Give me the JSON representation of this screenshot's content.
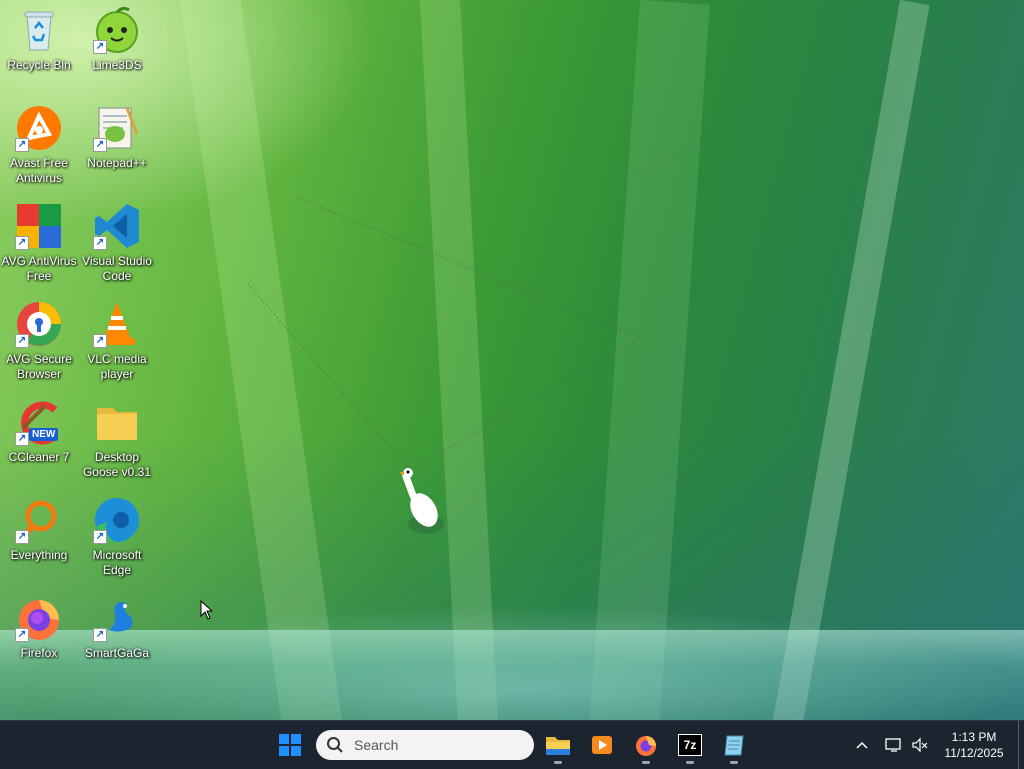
{
  "desktop_icons": [
    {
      "label": "Recycle Bin",
      "icon": "recycle-bin-icon"
    },
    {
      "label": "Lime3DS",
      "icon": "lime3ds-icon"
    },
    {
      "label": "Avast Free Antivirus",
      "icon": "avast-icon"
    },
    {
      "label": "Notepad++",
      "icon": "notepad-plus-plus-icon"
    },
    {
      "label": "AVG AntiVirus Free",
      "icon": "avg-antivirus-icon"
    },
    {
      "label": "Visual Studio Code",
      "icon": "vscode-icon"
    },
    {
      "label": "AVG Secure Browser",
      "icon": "avg-secure-browser-icon"
    },
    {
      "label": "VLC media player",
      "icon": "vlc-icon"
    },
    {
      "label": "CCleaner 7",
      "icon": "ccleaner-icon"
    },
    {
      "label": "Desktop Goose v0.31",
      "icon": "folder-icon"
    },
    {
      "label": "Everything",
      "icon": "everything-search-icon"
    },
    {
      "label": "Microsoft Edge",
      "icon": "edge-icon"
    },
    {
      "label": "Firefox",
      "icon": "firefox-icon"
    },
    {
      "label": "SmartGaGa",
      "icon": "smartgaga-icon"
    }
  ],
  "ccleaner_badge": "NEW",
  "taskbar": {
    "search_placeholder": "Search",
    "apps": [
      {
        "name": "File Explorer",
        "icon": "file-explorer-icon"
      },
      {
        "name": "Media Player",
        "icon": "media-player-icon"
      },
      {
        "name": "Firefox",
        "icon": "firefox-icon"
      },
      {
        "name": "7-Zip",
        "icon": "seven-zip-icon",
        "label": "7z"
      },
      {
        "name": "Notepad",
        "icon": "notepad-icon"
      }
    ],
    "clock": {
      "time": "1:13 PM",
      "date": "11/12/2025"
    }
  },
  "colors": {
    "taskbar_bg": "#1c2430",
    "win_blue": "#1e90ff",
    "wallpaper_green": "#3d9b35"
  }
}
